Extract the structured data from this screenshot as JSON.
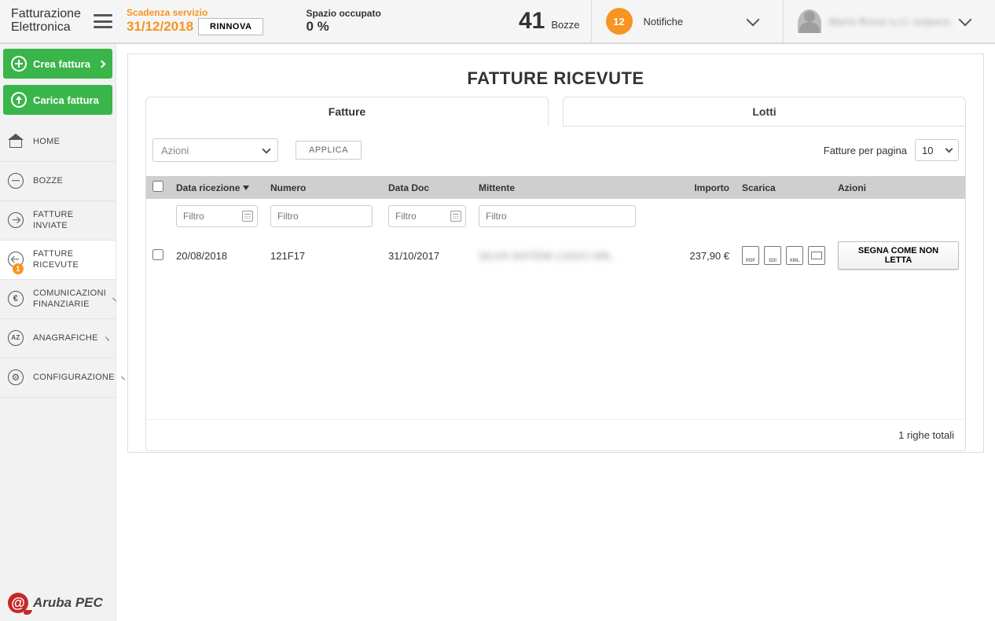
{
  "header": {
    "logo_line1": "Fatturazione",
    "logo_line2": "Elettronica",
    "service_label": "Scadenza servizio",
    "service_date": "31/12/2018",
    "renew_btn": "RINNOVA",
    "space_label": "Spazio occupato",
    "space_value": "0 %",
    "bozze_count": "41",
    "bozze_label": "Bozze",
    "notif_count": "12",
    "notif_label": "Notifiche",
    "user_name": "Mario Rossi s.r.l. unipers."
  },
  "sidebar": {
    "btn_create": "Crea fattura",
    "btn_upload": "Carica fattura",
    "items": [
      {
        "label": "HOME",
        "icon": "home"
      },
      {
        "label": "BOZZE",
        "icon": "minus"
      },
      {
        "label": "FATTURE INVIATE",
        "icon": "arrow-r"
      },
      {
        "label": "FATTURE RICEVUTE",
        "icon": "arrow-l",
        "badge": "1"
      },
      {
        "label": "COMUNICAZIONI FINANZIARIE",
        "icon": "euro"
      },
      {
        "label": "ANAGRAFICHE",
        "icon": "az"
      },
      {
        "label": "CONFIGURAZIONE",
        "icon": "gear"
      }
    ],
    "brand": "Aruba PEC"
  },
  "main": {
    "title": "FATTURE RICEVUTE",
    "tabs": {
      "t1": "Fatture",
      "t2": "Lotti"
    },
    "actions_placeholder": "Azioni",
    "apply_btn": "APPLICA",
    "perpage_label": "Fatture per pagina",
    "perpage_value": "10",
    "columns": {
      "c0": "",
      "c1": "Data ricezione",
      "c2": "Numero",
      "c3": "Data Doc",
      "c4": "Mittente",
      "c5": "Importo",
      "c6": "Scarica",
      "c7": "Azioni"
    },
    "filter_placeholder": "Filtro",
    "rows": [
      {
        "data_ricezione": "20/08/2018",
        "numero": "121F17",
        "data_doc": "31/10/2017",
        "mittente": "SILOS SISTEMI LOGICI SRL",
        "importo": "237,90 €",
        "action_btn": "SEGNA COME NON LETTA"
      }
    ],
    "footer_text": "1 righe totali"
  }
}
